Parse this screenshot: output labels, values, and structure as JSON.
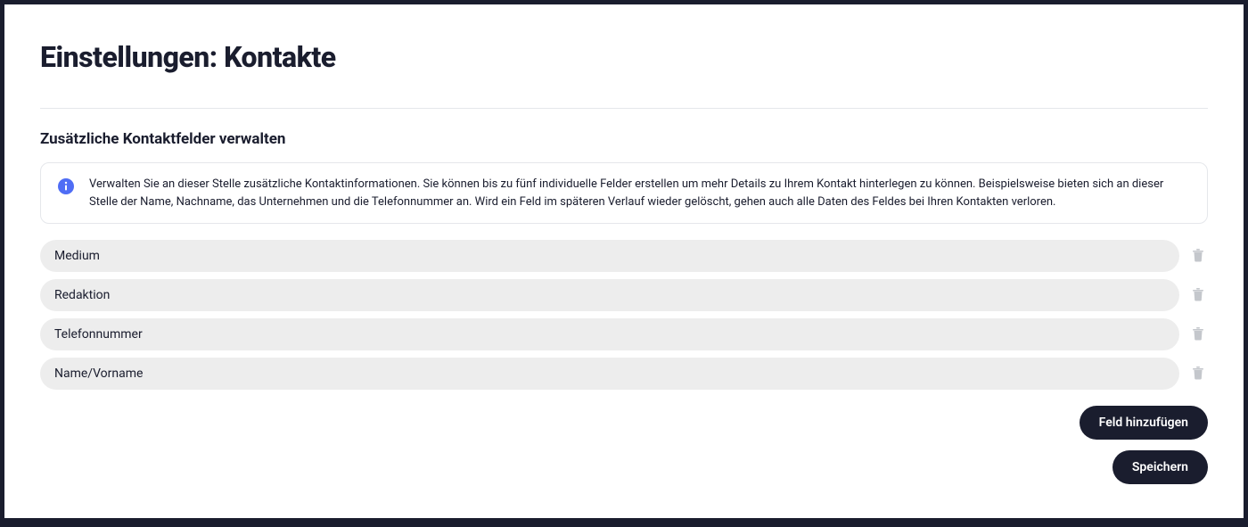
{
  "page": {
    "title": "Einstellungen: Kontakte"
  },
  "section": {
    "title": "Zusätzliche Kontaktfelder verwalten",
    "info": "Verwalten Sie an dieser Stelle zusätzliche Kontaktinformationen. Sie können bis zu fünf individuelle Felder erstellen um mehr Details zu Ihrem Kontakt hinterlegen zu können. Beispielsweise bieten sich an dieser Stelle der Name, Nachname, das Unternehmen und die Telefonnummer an. Wird ein Feld im späteren Verlauf wieder gelöscht, gehen auch alle Daten des Feldes bei Ihren Kontakten verloren."
  },
  "fields": [
    {
      "value": "Medium"
    },
    {
      "value": "Redaktion"
    },
    {
      "value": "Telefonnummer"
    },
    {
      "value": "Name/Vorname"
    }
  ],
  "actions": {
    "add_field_label": "Feld hinzufügen",
    "save_label": "Speichern"
  },
  "colors": {
    "accent": "#4f6df5",
    "dark": "#1a1d2e"
  }
}
